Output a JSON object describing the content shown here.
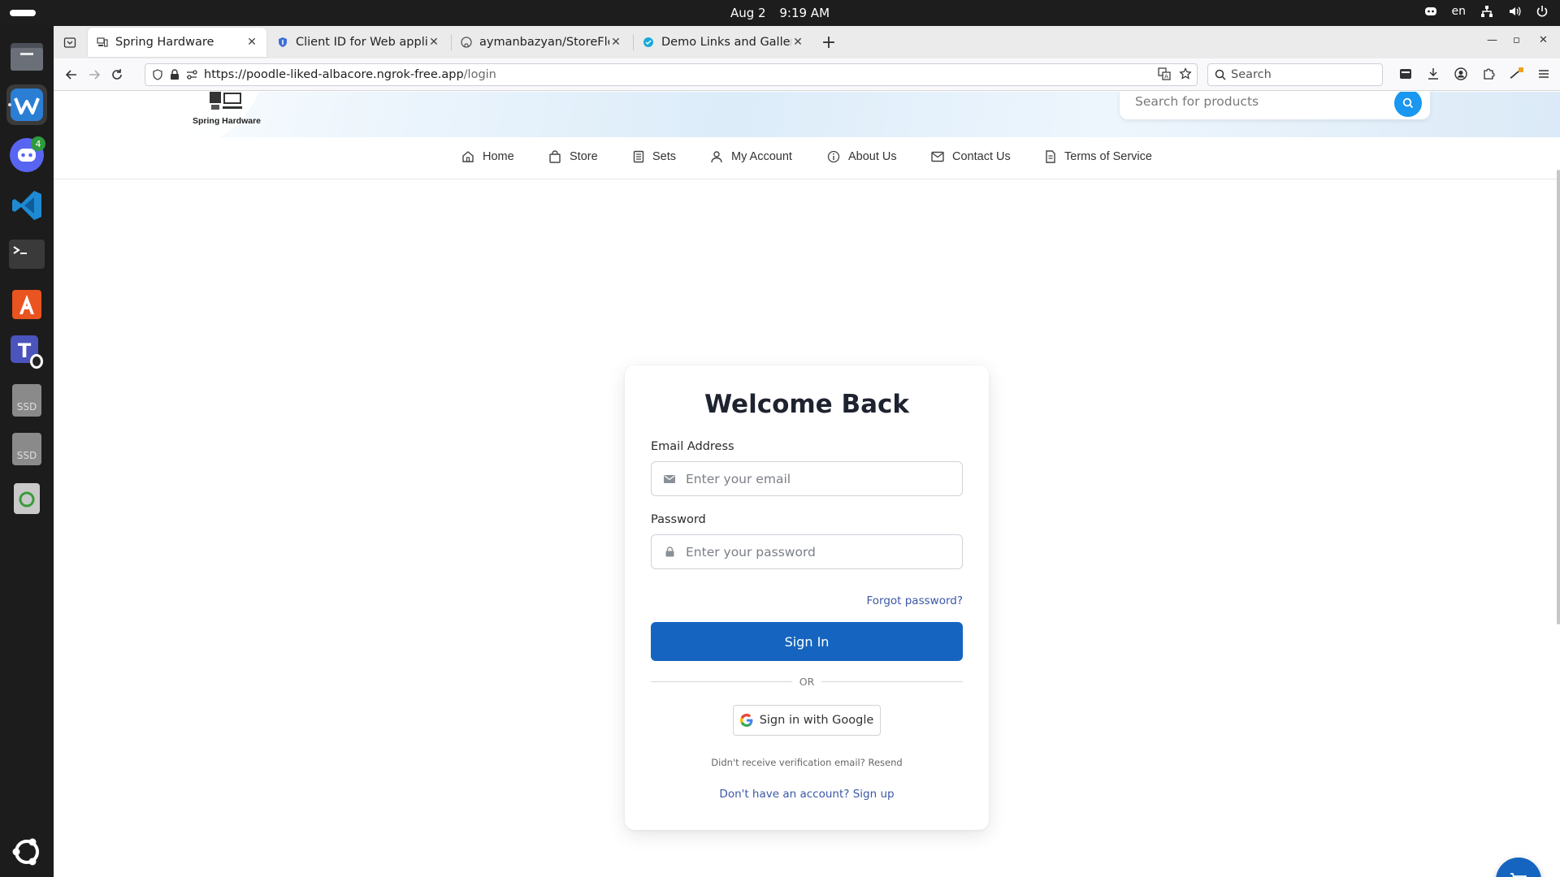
{
  "system": {
    "date": "Aug 2",
    "time": "9:19 AM",
    "language": "en"
  },
  "dock": {
    "discord_badge": "4"
  },
  "browser": {
    "tabs": [
      {
        "label": "Spring Hardware",
        "icon": "store-icon"
      },
      {
        "label": "Client ID for Web applicat",
        "icon": "shield-icon"
      },
      {
        "label": "aymanbazyan/StoreFlow·",
        "icon": "github-icon"
      },
      {
        "label": "Demo Links and Gallery |",
        "icon": "globe-icon"
      }
    ],
    "url_host": "https://poodle-liked-albacore.ngrok-free.app",
    "url_path": "/login",
    "search_placeholder": "Search"
  },
  "site": {
    "logo_text": "Spring Hardware",
    "search_placeholder": "Search for products",
    "nav": [
      {
        "label": "Home",
        "icon": "home-icon"
      },
      {
        "label": "Store",
        "icon": "bag-icon"
      },
      {
        "label": "Sets",
        "icon": "list-icon"
      },
      {
        "label": "My Account",
        "icon": "user-icon"
      },
      {
        "label": "About Us",
        "icon": "info-icon"
      },
      {
        "label": "Contact Us",
        "icon": "mail-icon"
      },
      {
        "label": "Terms of Service",
        "icon": "document-icon"
      }
    ]
  },
  "login": {
    "title": "Welcome Back",
    "email_label": "Email Address",
    "email_placeholder": "Enter your email",
    "password_label": "Password",
    "password_placeholder": "Enter your password",
    "forgot": "Forgot password?",
    "signin": "Sign In",
    "or": "OR",
    "google": "Sign in with Google",
    "resend": "Didn't receive verification email? Resend",
    "signup": "Don't have an account? Sign up"
  },
  "colors": {
    "primary": "#1565c0",
    "link": "#3b57a6",
    "search_button": "#1a97f0"
  }
}
